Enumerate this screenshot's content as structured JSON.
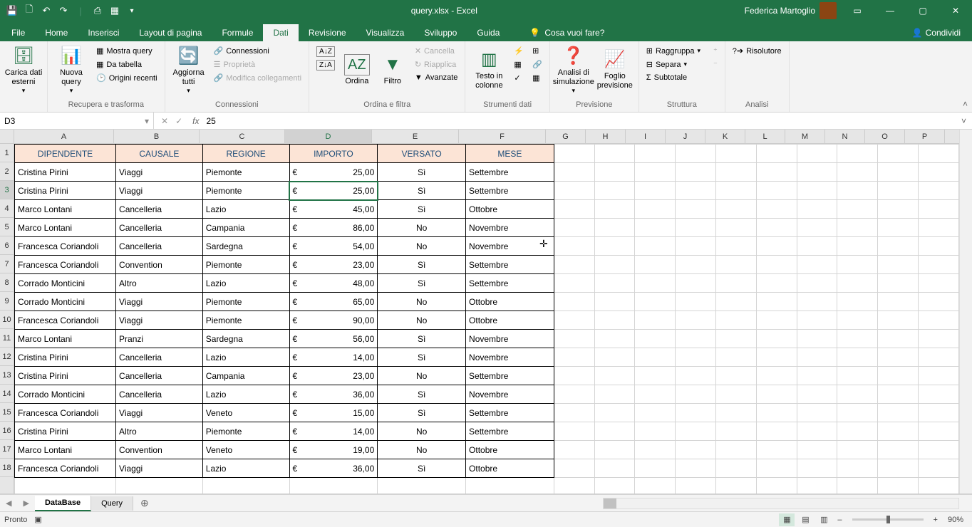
{
  "titlebar": {
    "title": "query.xlsx - Excel",
    "user": "Federica Martoglio"
  },
  "tabs": [
    "File",
    "Home",
    "Inserisci",
    "Layout di pagina",
    "Formule",
    "Dati",
    "Revisione",
    "Visualizza",
    "Sviluppo",
    "Guida"
  ],
  "active_tab": "Dati",
  "tellme": "Cosa vuoi fare?",
  "share": "Condividi",
  "ribbon": {
    "g1": {
      "btn": "Carica dati esterni"
    },
    "g2": {
      "btn": "Nuova query",
      "i1": "Mostra query",
      "i2": "Da tabella",
      "i3": "Origini recenti",
      "label": "Recupera e trasforma"
    },
    "g3": {
      "btn": "Aggiorna tutti",
      "i1": "Connessioni",
      "i2": "Proprietà",
      "i3": "Modifica collegamenti",
      "label": "Connessioni"
    },
    "g4": {
      "sort": "Ordina",
      "filter": "Filtro",
      "i1": "Cancella",
      "i2": "Riapplica",
      "i3": "Avanzate",
      "label": "Ordina e filtra"
    },
    "g5": {
      "btn": "Testo in colonne",
      "label": "Strumenti dati"
    },
    "g6": {
      "b1": "Analisi di simulazione",
      "b2": "Foglio previsione",
      "label": "Previsione"
    },
    "g7": {
      "i1": "Raggruppa",
      "i2": "Separa",
      "i3": "Subtotale",
      "label": "Struttura"
    },
    "g8": {
      "btn": "Risolutore",
      "label": "Analisi"
    }
  },
  "namebox": "D3",
  "formula": "25",
  "cols": {
    "A": 140,
    "B": 120,
    "C": 120,
    "D": 122,
    "E": 122,
    "F": 122,
    "G": 56,
    "H": 56,
    "I": 56,
    "J": 56,
    "K": 56,
    "L": 56,
    "M": 56,
    "N": 56,
    "O": 56,
    "P": 56
  },
  "headers": [
    "DIPENDENTE",
    "CAUSALE",
    "REGIONE",
    "IMPORTO",
    "VERSATO",
    "MESE"
  ],
  "rows": [
    {
      "a": "Cristina Pirini",
      "b": "Viaggi",
      "c": "Piemonte",
      "d": "25,00",
      "e": "Sì",
      "f": "Settembre"
    },
    {
      "a": "Cristina Pirini",
      "b": "Viaggi",
      "c": "Piemonte",
      "d": "25,00",
      "e": "Sì",
      "f": "Settembre"
    },
    {
      "a": "Marco Lontani",
      "b": "Cancelleria",
      "c": "Lazio",
      "d": "45,00",
      "e": "Sì",
      "f": "Ottobre"
    },
    {
      "a": "Marco Lontani",
      "b": "Cancelleria",
      "c": "Campania",
      "d": "86,00",
      "e": "No",
      "f": "Novembre"
    },
    {
      "a": "Francesca Coriandoli",
      "b": "Cancelleria",
      "c": "Sardegna",
      "d": "54,00",
      "e": "No",
      "f": "Novembre"
    },
    {
      "a": "Francesca Coriandoli",
      "b": "Convention",
      "c": "Piemonte",
      "d": "23,00",
      "e": "Sì",
      "f": "Settembre"
    },
    {
      "a": "Corrado Monticini",
      "b": "Altro",
      "c": "Lazio",
      "d": "48,00",
      "e": "Sì",
      "f": "Settembre"
    },
    {
      "a": "Corrado Monticini",
      "b": "Viaggi",
      "c": "Piemonte",
      "d": "65,00",
      "e": "No",
      "f": "Ottobre"
    },
    {
      "a": "Francesca Coriandoli",
      "b": "Viaggi",
      "c": "Piemonte",
      "d": "90,00",
      "e": "No",
      "f": "Ottobre"
    },
    {
      "a": "Marco Lontani",
      "b": "Pranzi",
      "c": "Sardegna",
      "d": "56,00",
      "e": "Sì",
      "f": "Novembre"
    },
    {
      "a": "Cristina Pirini",
      "b": "Cancelleria",
      "c": "Lazio",
      "d": "14,00",
      "e": "Sì",
      "f": "Novembre"
    },
    {
      "a": "Cristina Pirini",
      "b": "Cancelleria",
      "c": "Campania",
      "d": "23,00",
      "e": "No",
      "f": "Settembre"
    },
    {
      "a": "Corrado Monticini",
      "b": "Cancelleria",
      "c": "Lazio",
      "d": "36,00",
      "e": "Sì",
      "f": "Novembre"
    },
    {
      "a": "Francesca Coriandoli",
      "b": "Viaggi",
      "c": "Veneto",
      "d": "15,00",
      "e": "Sì",
      "f": "Settembre"
    },
    {
      "a": "Cristina Pirini",
      "b": "Altro",
      "c": "Piemonte",
      "d": "14,00",
      "e": "No",
      "f": "Settembre"
    },
    {
      "a": "Marco Lontani",
      "b": "Convention",
      "c": "Veneto",
      "d": "19,00",
      "e": "No",
      "f": "Ottobre"
    },
    {
      "a": "Francesca Coriandoli",
      "b": "Viaggi",
      "c": "Lazio",
      "d": "36,00",
      "e": "Sì",
      "f": "Ottobre"
    }
  ],
  "sheets": {
    "active": "DataBase",
    "other": "Query"
  },
  "status": {
    "ready": "Pronto",
    "zoom": "90%"
  },
  "chart_data": {
    "type": "table",
    "title": "query.xlsx",
    "columns": [
      "DIPENDENTE",
      "CAUSALE",
      "REGIONE",
      "IMPORTO",
      "VERSATO",
      "MESE"
    ],
    "rows": [
      [
        "Cristina Pirini",
        "Viaggi",
        "Piemonte",
        25.0,
        "Sì",
        "Settembre"
      ],
      [
        "Cristina Pirini",
        "Viaggi",
        "Piemonte",
        25.0,
        "Sì",
        "Settembre"
      ],
      [
        "Marco Lontani",
        "Cancelleria",
        "Lazio",
        45.0,
        "Sì",
        "Ottobre"
      ],
      [
        "Marco Lontani",
        "Cancelleria",
        "Campania",
        86.0,
        "No",
        "Novembre"
      ],
      [
        "Francesca Coriandoli",
        "Cancelleria",
        "Sardegna",
        54.0,
        "No",
        "Novembre"
      ],
      [
        "Francesca Coriandoli",
        "Convention",
        "Piemonte",
        23.0,
        "Sì",
        "Settembre"
      ],
      [
        "Corrado Monticini",
        "Altro",
        "Lazio",
        48.0,
        "Sì",
        "Settembre"
      ],
      [
        "Corrado Monticini",
        "Viaggi",
        "Piemonte",
        65.0,
        "No",
        "Ottobre"
      ],
      [
        "Francesca Coriandoli",
        "Viaggi",
        "Piemonte",
        90.0,
        "No",
        "Ottobre"
      ],
      [
        "Marco Lontani",
        "Pranzi",
        "Sardegna",
        56.0,
        "Sì",
        "Novembre"
      ],
      [
        "Cristina Pirini",
        "Cancelleria",
        "Lazio",
        14.0,
        "Sì",
        "Novembre"
      ],
      [
        "Cristina Pirini",
        "Cancelleria",
        "Campania",
        23.0,
        "No",
        "Settembre"
      ],
      [
        "Corrado Monticini",
        "Cancelleria",
        "Lazio",
        36.0,
        "Sì",
        "Novembre"
      ],
      [
        "Francesca Coriandoli",
        "Viaggi",
        "Veneto",
        15.0,
        "Sì",
        "Settembre"
      ],
      [
        "Cristina Pirini",
        "Altro",
        "Piemonte",
        14.0,
        "No",
        "Settembre"
      ],
      [
        "Marco Lontani",
        "Convention",
        "Veneto",
        19.0,
        "No",
        "Ottobre"
      ],
      [
        "Francesca Coriandoli",
        "Viaggi",
        "Lazio",
        36.0,
        "Sì",
        "Ottobre"
      ]
    ]
  }
}
